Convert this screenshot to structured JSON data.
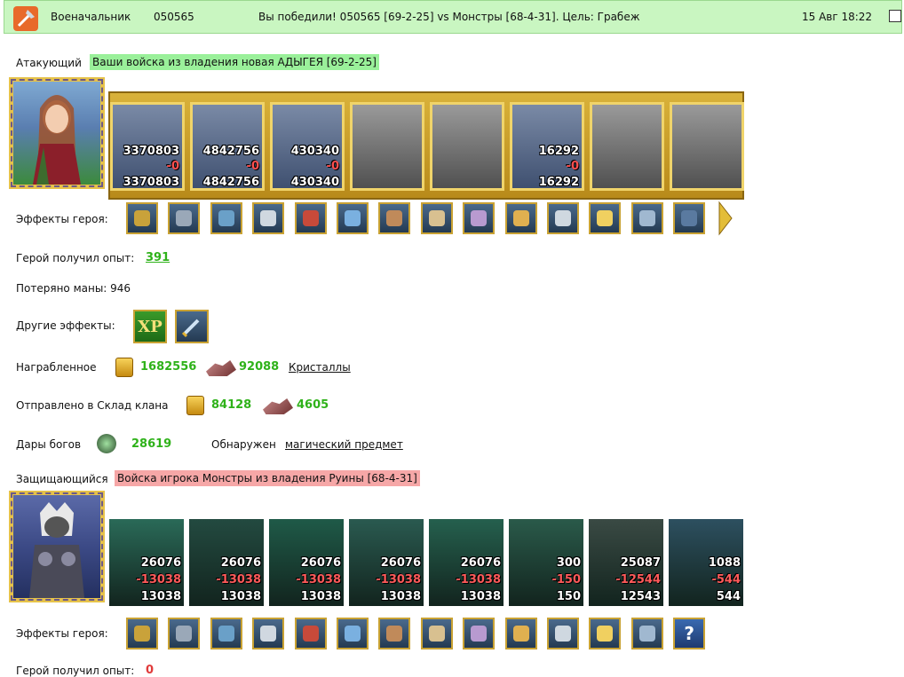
{
  "header": {
    "role": "Военачальник",
    "id": "050565",
    "result": "Вы победили! 050565 [69-2-25] vs Монстры [68-4-31]. Цель: Грабеж",
    "datetime": "15 Авг 18:22"
  },
  "attacker": {
    "label": "Атакующий",
    "title": "Ваши войска из владения новая АДЫГЕЯ [69-2-25]",
    "units": [
      {
        "top": "3370803",
        "mid": "-0",
        "bot": "3370803",
        "gray": false
      },
      {
        "top": "4842756",
        "mid": "-0",
        "bot": "4842756",
        "gray": false
      },
      {
        "top": "430340",
        "mid": "-0",
        "bot": "430340",
        "gray": false
      },
      {
        "top": "",
        "mid": "",
        "bot": "",
        "gray": true
      },
      {
        "top": "",
        "mid": "",
        "bot": "",
        "gray": true
      },
      {
        "top": "16292",
        "mid": "-0",
        "bot": "16292",
        "gray": false
      },
      {
        "top": "",
        "mid": "",
        "bot": "",
        "gray": true
      },
      {
        "top": "",
        "mid": "",
        "bot": "",
        "gray": true
      }
    ],
    "effects_label": "Эффекты героя:",
    "effects_icons": [
      "potion-icon",
      "armor-icon",
      "gloves-icon",
      "helmet-icon",
      "amulet-icon",
      "chest-armor-icon",
      "belt-icon",
      "boots-icon",
      "ring-icon",
      "scroll-icon",
      "sword-icon",
      "shield-icon",
      "gauntlet-icon",
      "cloak-icon"
    ],
    "xp_label": "Герой получил опыт:",
    "xp_value": "391",
    "mana_label": "Потеряно маны: 946",
    "other_effects_label": "Другие эффекты:",
    "other_effects_icons": [
      "xp-boost-icon",
      "sword-icon"
    ],
    "xp_badge": "XP",
    "loot_label": "Награбленное",
    "loot_gold": "1682556",
    "loot_crystals": "92088",
    "loot_crystals_link": "Кристаллы",
    "clan_label": "Отправлено в Склад клана",
    "clan_gold": "84128",
    "clan_crystals": "4605",
    "gifts_label": "Дары богов",
    "gifts_value": "28619",
    "found_label": "Обнаружен",
    "found_link": "магический предмет"
  },
  "defender": {
    "label": "Защищающийся",
    "title": "Войска игрока Монстры из владения Руины [68-4-31]",
    "units": [
      {
        "top": "26076",
        "mid": "-13038",
        "bot": "13038"
      },
      {
        "top": "26076",
        "mid": "-13038",
        "bot": "13038"
      },
      {
        "top": "26076",
        "mid": "-13038",
        "bot": "13038"
      },
      {
        "top": "26076",
        "mid": "-13038",
        "bot": "13038"
      },
      {
        "top": "26076",
        "mid": "-13038",
        "bot": "13038"
      },
      {
        "top": "300",
        "mid": "-150",
        "bot": "150"
      },
      {
        "top": "25087",
        "mid": "-12544",
        "bot": "12543"
      },
      {
        "top": "1088",
        "mid": "-544",
        "bot": "544"
      }
    ],
    "effects_label": "Эффекты героя:",
    "effects_icons": [
      "helmet-icon",
      "crossbow-icon",
      "shield-icon",
      "demon-mask-icon",
      "skeleton-icon",
      "pickaxe-icon",
      "fire-icon",
      "frost-armor-icon",
      "ice-armor-icon",
      "ice-ring-icon",
      "ice-wing-icon",
      "ice-staff-icon",
      "ice-shard-icon",
      "question-icon"
    ],
    "effects_question": "?",
    "xp_label": "Герой получил опыт:",
    "xp_value": "0"
  },
  "colors": {
    "header_bg": "#c9f6c1",
    "green_highlight": "#9af09a",
    "red_highlight": "#f6a7a7",
    "green_number": "#2fb21a",
    "red_number": "#e03a3a",
    "gold_frame": "#d9b23a"
  }
}
